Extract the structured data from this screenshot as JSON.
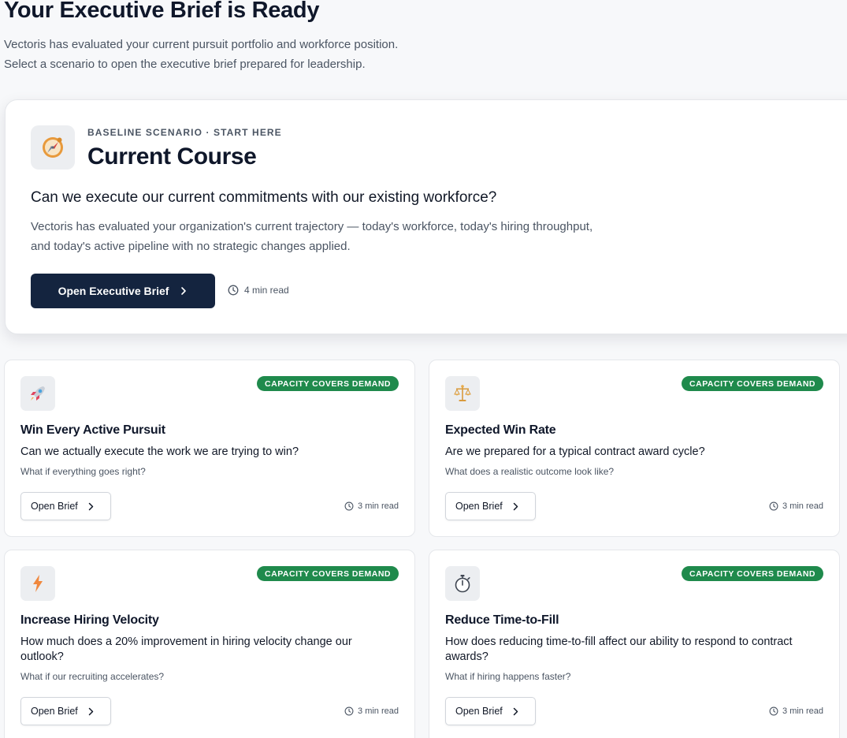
{
  "header": {
    "title": "Your Executive Brief is Ready",
    "subtitle_line1": "Vectoris has evaluated your current pursuit portfolio and workforce position.",
    "subtitle_line2": "Select a scenario to open the executive brief prepared for leadership."
  },
  "hero": {
    "icon": "compass-icon",
    "eyebrow": "BASELINE SCENARIO · START HERE",
    "title": "Current Course",
    "question": "Can we execute our current commitments with our existing workforce?",
    "description": "Vectoris has evaluated your organization's current trajectory — today's workforce, today's hiring throughput, and today's active pipeline with no strategic changes applied.",
    "button_label": "Open Executive Brief",
    "read_time": "4 min read"
  },
  "scenarios": [
    {
      "icon": "rocket-icon",
      "badge": "CAPACITY COVERS DEMAND",
      "title": "Win Every Active Pursuit",
      "question": "Can we actually execute the work we are trying to win?",
      "hint": "What if everything goes right?",
      "button_label": "Open Brief",
      "read_time": "3 min read"
    },
    {
      "icon": "balance-scale-icon",
      "badge": "CAPACITY COVERS DEMAND",
      "title": "Expected Win Rate",
      "question": "Are we prepared for a typical contract award cycle?",
      "hint": "What does a realistic outcome look like?",
      "button_label": "Open Brief",
      "read_time": "3 min read"
    },
    {
      "icon": "lightning-icon",
      "badge": "CAPACITY COVERS DEMAND",
      "title": "Increase Hiring Velocity",
      "question": "How much does a 20% improvement in hiring velocity change our outlook?",
      "hint": "What if our recruiting accelerates?",
      "button_label": "Open Brief",
      "read_time": "3 min read"
    },
    {
      "icon": "stopwatch-icon",
      "badge": "CAPACITY COVERS DEMAND",
      "title": "Reduce Time-to-Fill",
      "question": "How does reducing time-to-fill affect our ability to respond to contract awards?",
      "hint": "What if hiring happens faster?",
      "button_label": "Open Brief",
      "read_time": "3 min read"
    }
  ],
  "colors": {
    "primary_button": "#14243f",
    "badge_green": "#1f8a4c",
    "page_background": "#f7f8fa"
  }
}
